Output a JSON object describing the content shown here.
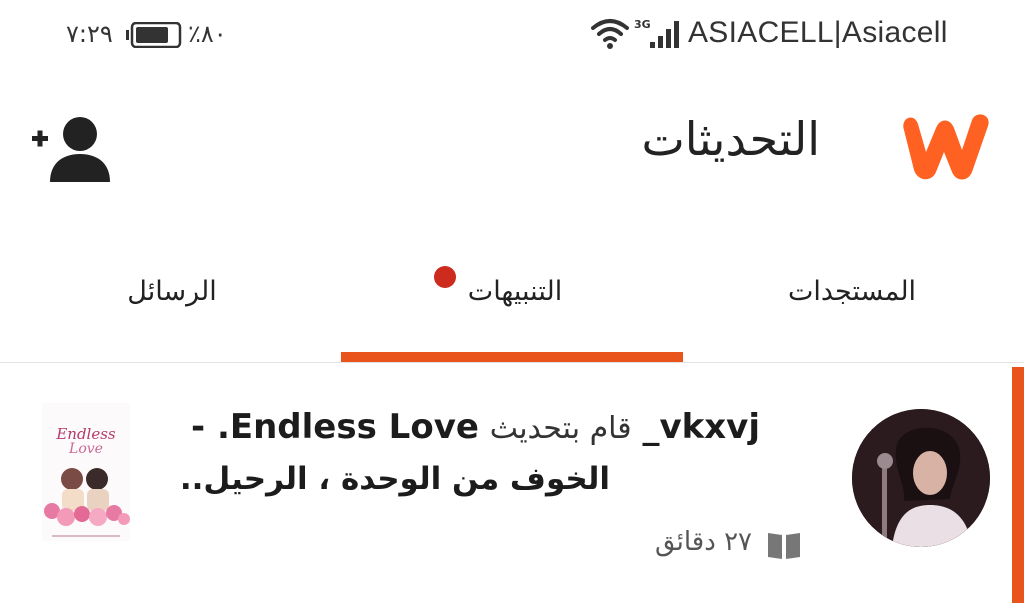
{
  "status_bar": {
    "time": "٧:٢٩",
    "battery_percent": "٪٨٠",
    "battery_level": 0.8,
    "network_type": "3G",
    "carrier": "ASIACELL|Asiacell"
  },
  "header": {
    "title": "التحديثات",
    "logo_icon": "wattpad-logo-icon",
    "add_user_icon": "add-user-icon",
    "brand_color": "#e8541b"
  },
  "tabs": [
    {
      "label": "المستجدات",
      "active": false
    },
    {
      "label": "التنبيهات",
      "active": true,
      "badge": "dot"
    },
    {
      "label": "الرسائل",
      "active": false
    }
  ],
  "notification": {
    "username": "vkxvj_",
    "action": "قام بتحديث",
    "story_title": "Endless Love. -",
    "chapter_title": "الخوف من الوحدة ، الرحيل..",
    "time_ago": "٢٧ دقائق",
    "cover_title": "Endless",
    "cover_subtitle": "Love",
    "meta_icon": "book-icon"
  }
}
